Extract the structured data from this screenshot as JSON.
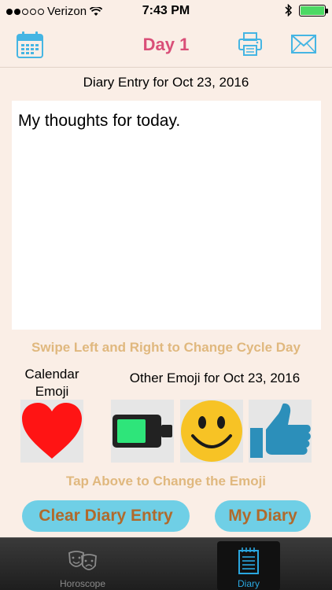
{
  "status": {
    "carrier": "Verizon",
    "time": "7:43 PM"
  },
  "nav": {
    "title": "Day 1",
    "calendar_icon": "calendar-icon",
    "print_icon": "printer-icon",
    "mail_icon": "envelope-icon"
  },
  "diary": {
    "date_line": "Diary Entry for Oct 23, 2016",
    "entry_text": "My thoughts for today."
  },
  "hints": {
    "swipe": "Swipe Left and Right to Change Cycle Day",
    "tap": "Tap Above to Change the Emoji"
  },
  "emoji": {
    "calendar_label": "Calendar Emoji",
    "other_label": "Other Emoji for Oct 23, 2016",
    "calendar_emoji": "heart-icon",
    "others": [
      "battery-icon",
      "smiley-icon",
      "thumbs-up-icon"
    ]
  },
  "buttons": {
    "clear": "Clear Diary Entry",
    "my_diary": "My Diary"
  },
  "tabs": {
    "horoscope": "Horoscope",
    "diary": "Diary",
    "selected": "Diary"
  },
  "colors": {
    "accent_title": "#d94f78",
    "hint_text": "#e0b87e",
    "button_bg": "#6fcfe6",
    "button_text": "#b06a2c",
    "icon_blue": "#45b5e3",
    "tab_selected": "#2aa7e0"
  }
}
